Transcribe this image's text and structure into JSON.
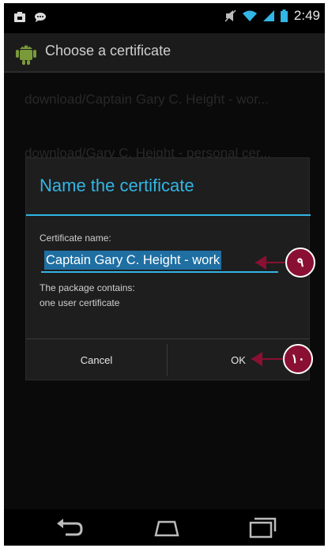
{
  "status_bar": {
    "time": "2:49"
  },
  "action_bar": {
    "title": "Choose a certificate"
  },
  "list": [
    {
      "label": "download/Captain Gary C. Height - wor..."
    },
    {
      "label": "download/Gary C. Height - personal cer..."
    }
  ],
  "dialog": {
    "title": "Name the certificate",
    "name_label": "Certificate name:",
    "name_value": "Captain Gary C. Height - work",
    "info_line1": "The package contains:",
    "info_line2": "one user certificate",
    "cancel_label": "Cancel",
    "ok_label": "OK"
  },
  "callouts": {
    "step9": "٩",
    "step10": "١٠"
  },
  "colors": {
    "accent": "#33b5e5",
    "callout": "#8a1033"
  },
  "icons": [
    "notification-icon",
    "chat-icon",
    "mute-icon",
    "wifi-icon",
    "signal-icon",
    "battery-icon",
    "android-app-icon",
    "back-icon",
    "home-icon",
    "recent-apps-icon"
  ]
}
